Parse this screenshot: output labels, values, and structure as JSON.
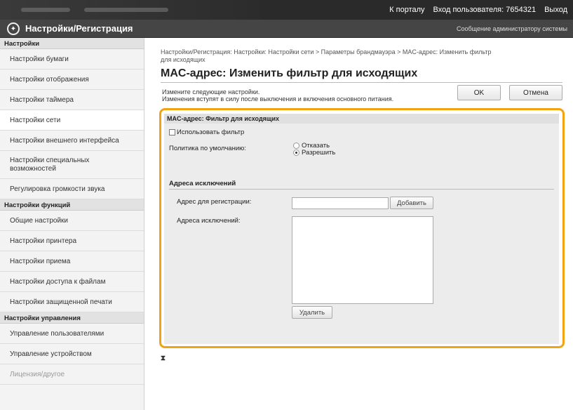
{
  "topbar": {
    "portal_link": "К порталу",
    "login_label": "Вход пользователя:",
    "login_id": "7654321",
    "logout_link": "Выход"
  },
  "header": {
    "title": "Настройки/Регистрация",
    "admin_message": "Сообщение администратору системы"
  },
  "sidebar": {
    "groups": [
      {
        "label": "Настройки",
        "items": [
          {
            "label": "Настройки бумаги"
          },
          {
            "label": "Настройки отображения"
          },
          {
            "label": "Настройки таймера"
          },
          {
            "label": "Настройки сети"
          },
          {
            "label": "Настройки внешнего интерфейса"
          },
          {
            "label_line1": "Настройки специальных",
            "label_line2": "возможностей"
          },
          {
            "label": "Регулировка громкости звука"
          }
        ]
      },
      {
        "label": "Настройки функций",
        "items": [
          {
            "label": "Общие настройки"
          },
          {
            "label": "Настройки принтера"
          },
          {
            "label": "Настройки приема"
          },
          {
            "label": "Настройки доступа к файлам"
          },
          {
            "label": "Настройки защищенной печати"
          }
        ]
      },
      {
        "label": "Настройки управления",
        "items": [
          {
            "label": "Управление пользователями"
          },
          {
            "label": "Управление устройством"
          },
          {
            "label": "Лицензия/другое"
          }
        ]
      }
    ]
  },
  "main": {
    "breadcrumb_line1": "Настройки/Регистрация: Настройки: Настройки сети > Параметры брандмауэра > MAC-адрес: Изменить фильтр",
    "breadcrumb_line2": "для исходящих",
    "page_title": "MAC-адрес: Изменить фильтр для исходящих",
    "instructions_line1": "Измените следующие настройки.",
    "instructions_line2": "Изменения вступят в силу после выключения и включения основного питания.",
    "ok_label": "OK",
    "cancel_label": "Отмена",
    "section": {
      "header": "MAC-адрес: Фильтр для исходящих",
      "use_filter_label": "Использовать фильтр",
      "use_filter_checked": false,
      "default_policy_label": "Политика по умолчанию:",
      "policy_options": [
        "Отказать",
        "Разрешить"
      ],
      "policy_selected": "Разрешить",
      "exceptions_heading": "Адреса исключений",
      "register_address_label": "Адрес для регистрации:",
      "register_address_value": "",
      "add_button": "Добавить",
      "exception_addresses_label": "Адреса исключений:",
      "delete_button": "Удалить"
    },
    "top_link_glyph": "⧗"
  },
  "colors": {
    "highlight": "#f0a414",
    "header_bg": "#454545",
    "topbar_bg": "#2a2a2a"
  }
}
